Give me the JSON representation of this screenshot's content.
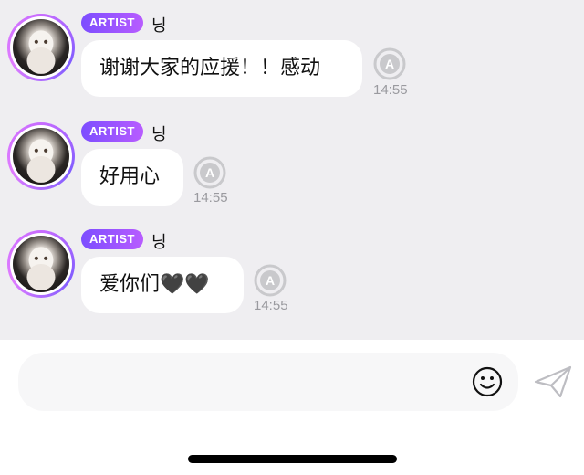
{
  "messages": [
    {
      "badge": "ARTIST",
      "name": "닝",
      "text": "谢谢大家的应援！！感动",
      "time": "14:55"
    },
    {
      "badge": "ARTIST",
      "name": "닝",
      "text": "好用心",
      "time": "14:55"
    },
    {
      "badge": "ARTIST",
      "name": "닝",
      "text": "爱你们",
      "hearts": "🖤🖤",
      "time": "14:55"
    }
  ],
  "composer": {
    "value": "",
    "placeholder": ""
  },
  "icons": {
    "translate": "translate-icon",
    "emoji": "smiley-icon",
    "send": "paper-plane-icon"
  },
  "colors": {
    "chat_background": "#efeef1",
    "badge_gradient_start": "#7c4dff",
    "badge_gradient_end": "#b85cff",
    "timestamp": "#9a9a9f"
  }
}
